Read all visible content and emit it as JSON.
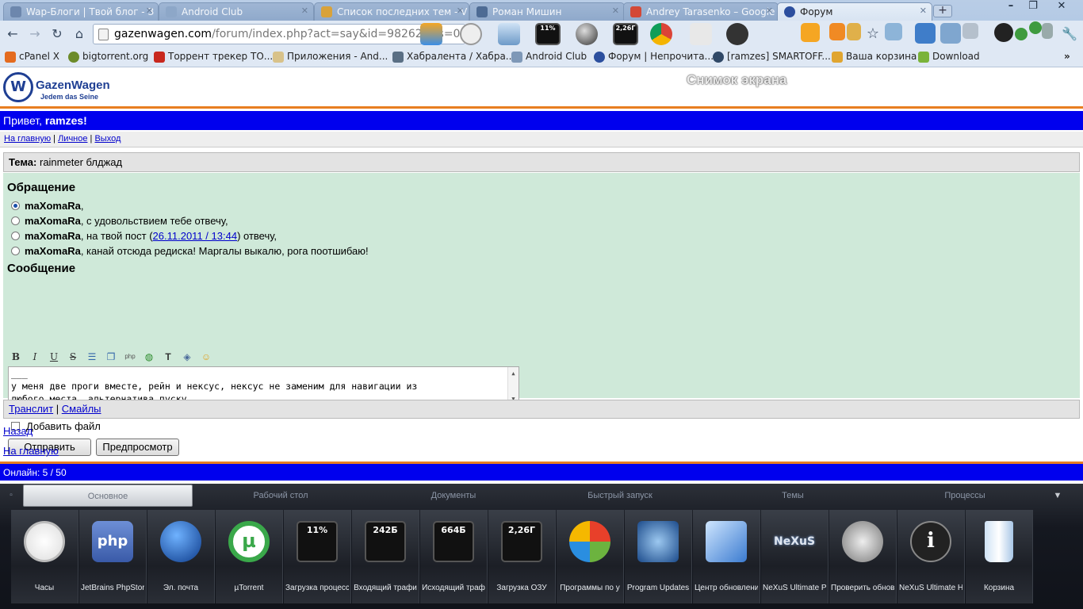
{
  "browser": {
    "tabs": [
      {
        "label": "Wap-Блоги | Твой блог - З",
        "icon": "wap-icon"
      },
      {
        "label": "Android Club",
        "icon": "android-icon"
      },
      {
        "label": "Список последних тем - V",
        "icon": "v-icon"
      },
      {
        "label": "Роман Мишин",
        "icon": "v-icon"
      },
      {
        "label": "Andrey Tarasenko – Google",
        "icon": "gplus-icon"
      },
      {
        "label": "Форум",
        "icon": "vw-icon"
      }
    ],
    "url_host": "gazenwagen.com",
    "url_path": "/forum/index.php?act=say&id=982623&s=0",
    "bookmarks": [
      "cPanel X",
      "bigtorrent.org",
      "Торрент трекер ТО...",
      "Приложения - And...",
      "Хабралента / Хабра...",
      "Android Club",
      "Форум | Непрочита...",
      "[ramzes] SMARTOFF...",
      "Ваша корзина",
      "Download"
    ],
    "toolbar_meter_1": "11%",
    "toolbar_meter_2": "2,26Г"
  },
  "site": {
    "logo_name": "GazenWagen",
    "logo_slogan": "Jedem das Seine",
    "logo_letter": "W",
    "watermark": "Снимок экрана",
    "greeting_prefix": "Привет,",
    "username": "ramzes!",
    "nav": [
      "На главную",
      "Личное",
      "Выход"
    ]
  },
  "topic": {
    "label": "Тема:",
    "title": "rainmeter блджад"
  },
  "form": {
    "address_title": "Обращение",
    "recipient": "maXomaRa",
    "options": [
      {
        "suffix": ",",
        "selected": true
      },
      {
        "suffix": ", с удовольствием тебе отвечу,",
        "selected": false
      },
      {
        "suffix_pre": ", на твой пост (",
        "link": "26.11.2011 / 13:44",
        "suffix_post": ") отвечу,",
        "selected": false
      },
      {
        "suffix": ", канай отсюда редиска! Маргалы выкалю, рога поотшибаю!",
        "selected": false
      }
    ],
    "message_title": "Сообщение",
    "message_lines": [
      "___",
      "у меня две проги вместе, рейн и нексус, нексус не заменим для навигации из",
      "любого места, альтернатива пуску"
    ],
    "attach_label": "Добавить файл",
    "send_button": "Отправить",
    "preview_button": "Предпросмотр"
  },
  "footer": {
    "translit": "Транслит",
    "smiles": "Смайлы",
    "back": "Назад",
    "home": "На главную",
    "online": "Онлайн: 5 / 50"
  },
  "dock": {
    "tabs": [
      "Основное",
      "Рабочий стол",
      "Документы",
      "Быстрый запуск",
      "Темы",
      "Процессы"
    ],
    "active_tab": "Основное",
    "items": [
      {
        "label": "Часы",
        "icon": "clock-icon"
      },
      {
        "label": "JetBrains PhpStor",
        "icon": "php-icon"
      },
      {
        "label": "Эл. почта",
        "icon": "mail-globe-icon"
      },
      {
        "label": "µTorrent",
        "icon": "utorrent-icon"
      },
      {
        "label": "Загрузка процесс",
        "icon": "cpu-meter-icon",
        "meter": "11%"
      },
      {
        "label": "Входящий трафи",
        "icon": "download-meter-icon",
        "meter": "242Б"
      },
      {
        "label": "Исходящий траф",
        "icon": "upload-meter-icon",
        "meter": "664Б"
      },
      {
        "label": "Загрузка ОЗУ",
        "icon": "ram-meter-icon",
        "meter": "2,26Г"
      },
      {
        "label": "Программы по у",
        "icon": "default-programs-icon"
      },
      {
        "label": "Program Updates",
        "icon": "updates-icon"
      },
      {
        "label": "Центр обновлени",
        "icon": "windows-update-icon"
      },
      {
        "label": "NeXuS Ultimate Pr",
        "icon": "nexus-icon",
        "badge": "NeXuS"
      },
      {
        "label": "Проверить обнов",
        "icon": "check-updates-icon"
      },
      {
        "label": "NeXuS Ultimate H",
        "icon": "info-icon"
      },
      {
        "label": "Корзина",
        "icon": "recycle-bin-icon"
      }
    ]
  }
}
